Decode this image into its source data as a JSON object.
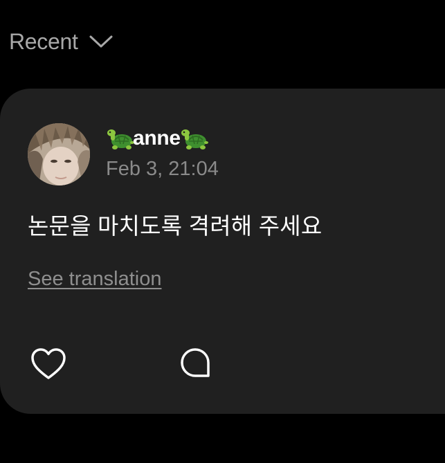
{
  "header": {
    "filter_label": "Recent",
    "filter_icon": "chevron-down-icon"
  },
  "post": {
    "author_name": "anne",
    "author_emoji": "turtle",
    "timestamp": "Feb 3, 21:04",
    "message": "논문을 마치도록 격려해 주세요",
    "translate_label": "See translation",
    "actions": [
      {
        "icon": "heart-icon"
      },
      {
        "icon": "comment-bubble-icon"
      }
    ]
  },
  "colors": {
    "background": "#000000",
    "card": "#202020",
    "primary_text": "#ffffff",
    "secondary_text": "#8a8a8a"
  }
}
